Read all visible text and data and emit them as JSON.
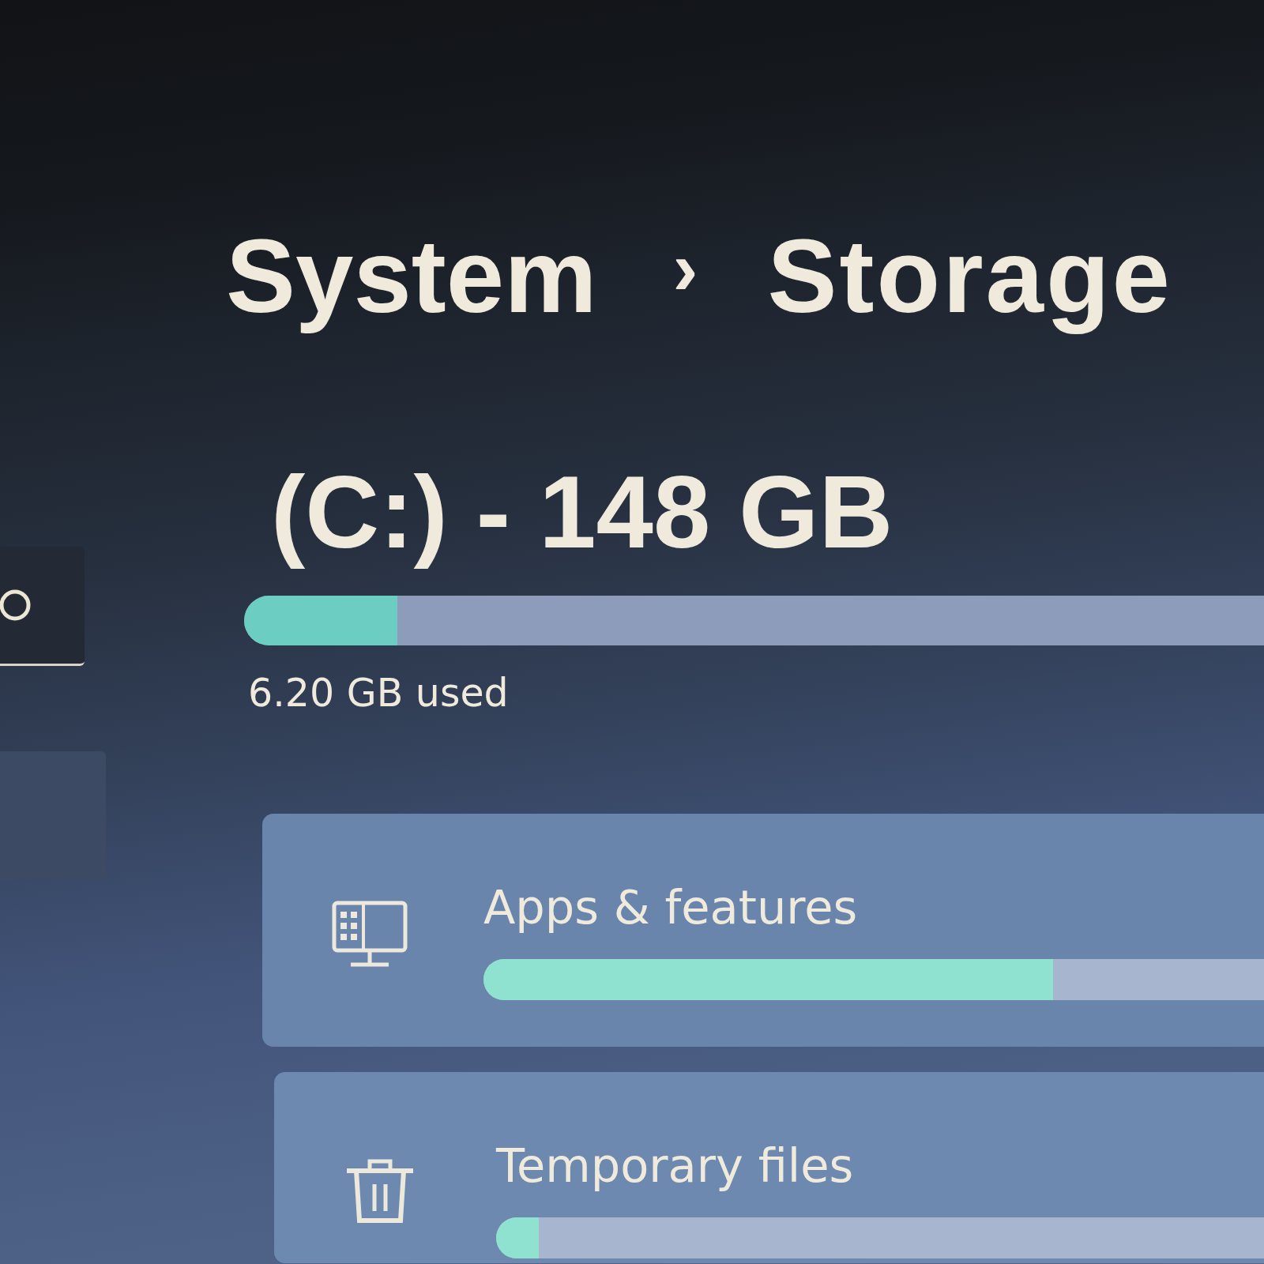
{
  "breadcrumb": {
    "parent": "System",
    "separator": "›",
    "current": "Storage"
  },
  "drive": {
    "title": "(C:) - 148 GB",
    "level": 0.15,
    "reading": "6.20 GB used"
  },
  "categories": [
    {
      "name": "Apps & features",
      "kind": "apps",
      "level": 0.73
    },
    {
      "name": "Temporary files",
      "kind": "temp",
      "level": 0.056
    }
  ]
}
